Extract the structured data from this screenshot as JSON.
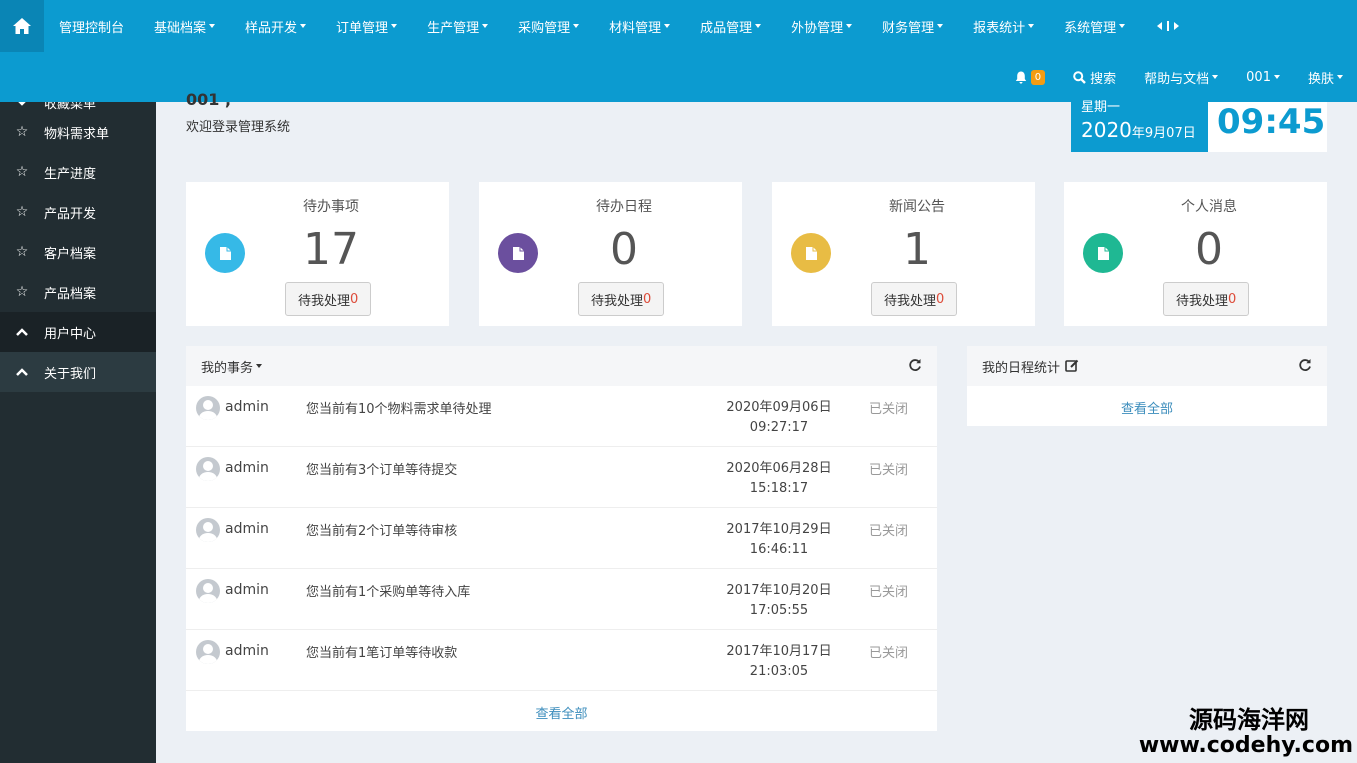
{
  "colors": {
    "primary": "#0c9bd0",
    "sidebar": "#222d32",
    "badge": "#f39c12",
    "link": "#3c8dbc"
  },
  "nav": {
    "home_icon": "home-icon",
    "items": [
      {
        "label": "管理控制台",
        "dropdown": false
      },
      {
        "label": "基础档案",
        "dropdown": true
      },
      {
        "label": "样品开发",
        "dropdown": true
      },
      {
        "label": "订单管理",
        "dropdown": true
      },
      {
        "label": "生产管理",
        "dropdown": true
      },
      {
        "label": "采购管理",
        "dropdown": true
      },
      {
        "label": "材料管理",
        "dropdown": true
      },
      {
        "label": "成品管理",
        "dropdown": true
      },
      {
        "label": "外协管理",
        "dropdown": true
      },
      {
        "label": "财务管理",
        "dropdown": true
      },
      {
        "label": "报表统计",
        "dropdown": true
      },
      {
        "label": "系统管理",
        "dropdown": true
      }
    ],
    "collapse_icon": "collapse-arrows-icon",
    "row2": {
      "notification_count": "0",
      "search_label": "搜索",
      "help_label": "帮助与文档",
      "user_label": "001",
      "skin_label": "换肤"
    }
  },
  "sidebar": {
    "partial_item": "收藏菜单",
    "favorites": [
      "物料需求单",
      "生产进度",
      "产品开发",
      "客户档案",
      "产品档案"
    ],
    "groups": [
      "用户中心",
      "关于我们"
    ]
  },
  "welcome": {
    "user": "001 ,",
    "text": "欢迎登录管理系统"
  },
  "clock": {
    "weekday": "星期一",
    "year": "2020",
    "month_day": "年9月07日",
    "time": "09:45"
  },
  "stats": [
    {
      "title": "待办事项",
      "value": "17",
      "button": "待我处理",
      "count": "0",
      "color": "#36b9e7"
    },
    {
      "title": "待办日程",
      "value": "0",
      "button": "待我处理",
      "count": "0",
      "color": "#6b4f9e"
    },
    {
      "title": "新闻公告",
      "value": "1",
      "button": "待我处理",
      "count": "0",
      "color": "#e8bc44"
    },
    {
      "title": "个人消息",
      "value": "0",
      "button": "待我处理",
      "count": "0",
      "color": "#1fb893"
    }
  ],
  "tasks_panel": {
    "title": "我的事务",
    "view_all": "查看全部",
    "rows": [
      {
        "user": "admin",
        "message": "您当前有10个物料需求单待处理",
        "date": "2020年09月06日",
        "time": "09:27:17",
        "status": "已关闭"
      },
      {
        "user": "admin",
        "message": "您当前有3个订单等待提交",
        "date": "2020年06月28日",
        "time": "15:18:17",
        "status": "已关闭"
      },
      {
        "user": "admin",
        "message": "您当前有2个订单等待审核",
        "date": "2017年10月29日",
        "time": "16:46:11",
        "status": "已关闭"
      },
      {
        "user": "admin",
        "message": "您当前有1个采购单等待入库",
        "date": "2017年10月20日",
        "time": "17:05:55",
        "status": "已关闭"
      },
      {
        "user": "admin",
        "message": "您当前有1笔订单等待收款",
        "date": "2017年10月17日",
        "time": "21:03:05",
        "status": "已关闭"
      }
    ]
  },
  "schedule_panel": {
    "title": "我的日程统计",
    "view_all": "查看全部"
  },
  "watermark": {
    "cn": "源码海洋网",
    "en": "www.codehy.com"
  }
}
